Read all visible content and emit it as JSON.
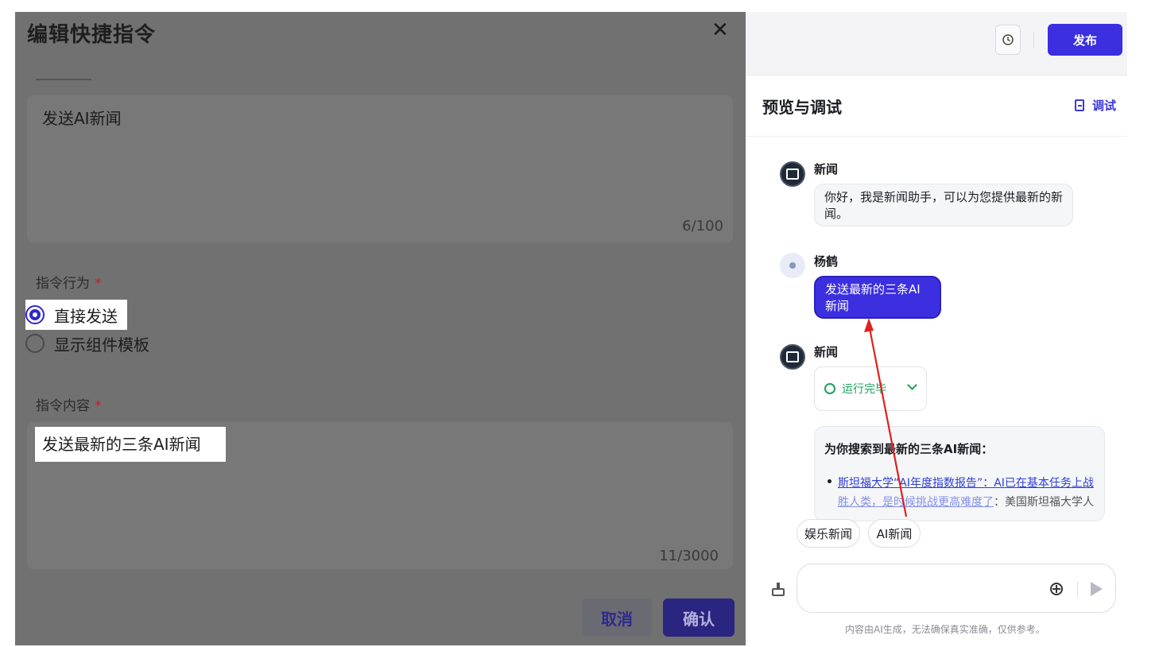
{
  "modal": {
    "title": "编辑快捷指令",
    "close_icon": "✕",
    "name_value": "发送AI新闻",
    "name_count": "6/100",
    "behavior_label": "指令行为",
    "required_mark": "*",
    "options": [
      {
        "label": "直接发送",
        "selected": true
      },
      {
        "label": "显示组件模板",
        "selected": false
      }
    ],
    "content_label": "指令内容",
    "content_value": "发送最新的三条AI新闻",
    "content_count": "11/3000",
    "cancel_label": "取消",
    "confirm_label": "确认"
  },
  "topbar": {
    "history_icon": "clock-history-icon",
    "publish_label": "发布"
  },
  "preview": {
    "title": "预览与调试",
    "debug_label": "调试",
    "messages": [
      {
        "sender": "新闻",
        "text": "你好，我是新闻助手，可以为您提供最新的新闻。"
      },
      {
        "sender": "杨鹤",
        "text": "发送最新的三条AI新闻"
      },
      {
        "sender": "新闻",
        "status": "运行完毕"
      }
    ],
    "result": {
      "heading": "为你搜索到最新的三条AI新闻：",
      "line1": "斯坦福大学“AI年度指数报告”：AI已在基本任务上战",
      "line2_link": "胜人类，是时候挑战更高难度了",
      "line2_plain": "：美国斯坦福大学人"
    },
    "chips": [
      "娱乐新闻",
      "AI新闻"
    ],
    "disclaimer": "内容由AI生成，无法确保真实准确，仅供参考。"
  },
  "colors": {
    "accent": "#3b2fe0",
    "status_green": "#1fa160",
    "annotation_arrow": "#e02020"
  }
}
